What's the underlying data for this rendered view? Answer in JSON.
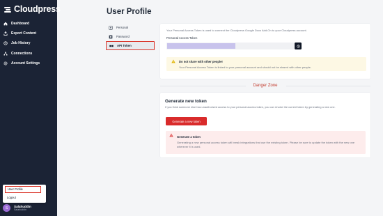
{
  "brand": {
    "name": "Cloudpress"
  },
  "sidebar": {
    "items": [
      {
        "label": "Dashboard",
        "icon": "home-icon"
      },
      {
        "label": "Export Content",
        "icon": "export-icon"
      },
      {
        "label": "Job History",
        "icon": "history-icon"
      },
      {
        "label": "Connections",
        "icon": "connections-icon"
      },
      {
        "label": "Account Settings",
        "icon": "gear-icon"
      }
    ]
  },
  "user_menu": {
    "profile_label": "User Profile",
    "logout_label": "Logout"
  },
  "user": {
    "name": "Salahuddin",
    "handle": "Salahuddin",
    "initial": "S"
  },
  "page": {
    "title": "User Profile"
  },
  "subnav": {
    "items": [
      {
        "label": "Personal",
        "icon": "user-icon"
      },
      {
        "label": "Password",
        "icon": "lock-icon"
      },
      {
        "label": "API Token",
        "icon": "key-icon",
        "active": true
      }
    ]
  },
  "token": {
    "intro": "Your Personal Access Token is used to connect the Cloudpress Google Docs Add-On to your Cloudpress account.",
    "label": "Personal Access Token"
  },
  "warning": {
    "title": "Do not share with other people!",
    "body": "Your Personal Access Token is linked to your personal account and should not be shared with other people."
  },
  "danger_zone": {
    "label": "Danger Zone"
  },
  "generate": {
    "title": "Generate new token",
    "description": "If you think someone else has unauthorized access to your personal access token, you can revoke the current token by generating a new one.",
    "button_label": "Generate a new token",
    "alert_title": "Generate a token",
    "alert_body": "Generating a new personal access token will break integrations that use the existing token. Please be sure to update the token with the new one wherever it is used."
  },
  "colors": {
    "sidebar_bg": "#1b2335",
    "danger": "#d92b2b",
    "accent_token": "#c8c3ec",
    "warning_bg": "#fdf8e4",
    "alert_bg": "#fdecec"
  }
}
